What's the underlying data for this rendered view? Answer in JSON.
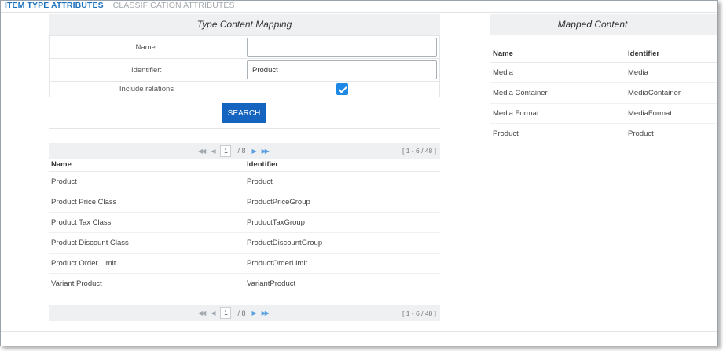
{
  "tabs": [
    {
      "label": "ITEM TYPE ATTRIBUTES",
      "active": true
    },
    {
      "label": "CLASSIFICATION ATTRIBUTES",
      "active": false
    }
  ],
  "search_panel": {
    "title": "Type Content Mapping",
    "fields": {
      "name_label": "Name:",
      "name_value": "",
      "identifier_label": "Identifier:",
      "identifier_value": "Product",
      "include_relations_label": "Include relations",
      "include_relations_checked": true
    },
    "search_button": "SEARCH"
  },
  "pager": {
    "current_page": "1",
    "total_pages": "/ 8",
    "range": "[ 1 - 6 / 48 ]",
    "icons": [
      "first-page-icon",
      "prev-page-icon",
      "next-page-icon",
      "last-page-icon"
    ]
  },
  "results": {
    "columns": [
      "Name",
      "Identifier"
    ],
    "rows": [
      {
        "name": "Product",
        "identifier": "Product"
      },
      {
        "name": "Product Price Class",
        "identifier": "ProductPriceGroup"
      },
      {
        "name": "Product Tax Class",
        "identifier": "ProductTaxGroup"
      },
      {
        "name": "Product Discount Class",
        "identifier": "ProductDiscountGroup"
      },
      {
        "name": "Product Order Limit",
        "identifier": "ProductOrderLimit"
      },
      {
        "name": "Variant Product",
        "identifier": "VariantProduct"
      }
    ]
  },
  "mapped_panel": {
    "title": "Mapped Content",
    "columns": [
      "Name",
      "Identifier"
    ],
    "rows": [
      {
        "name": "Media",
        "identifier": "Media"
      },
      {
        "name": "Media Container",
        "identifier": "MediaContainer"
      },
      {
        "name": "Media Format",
        "identifier": "MediaFormat"
      },
      {
        "name": "Product",
        "identifier": "Product"
      }
    ]
  },
  "colors": {
    "accent": "#1e73be",
    "button": "#1565c0",
    "checkbox": "#1e88e5",
    "header_bg": "#eef0f2"
  }
}
